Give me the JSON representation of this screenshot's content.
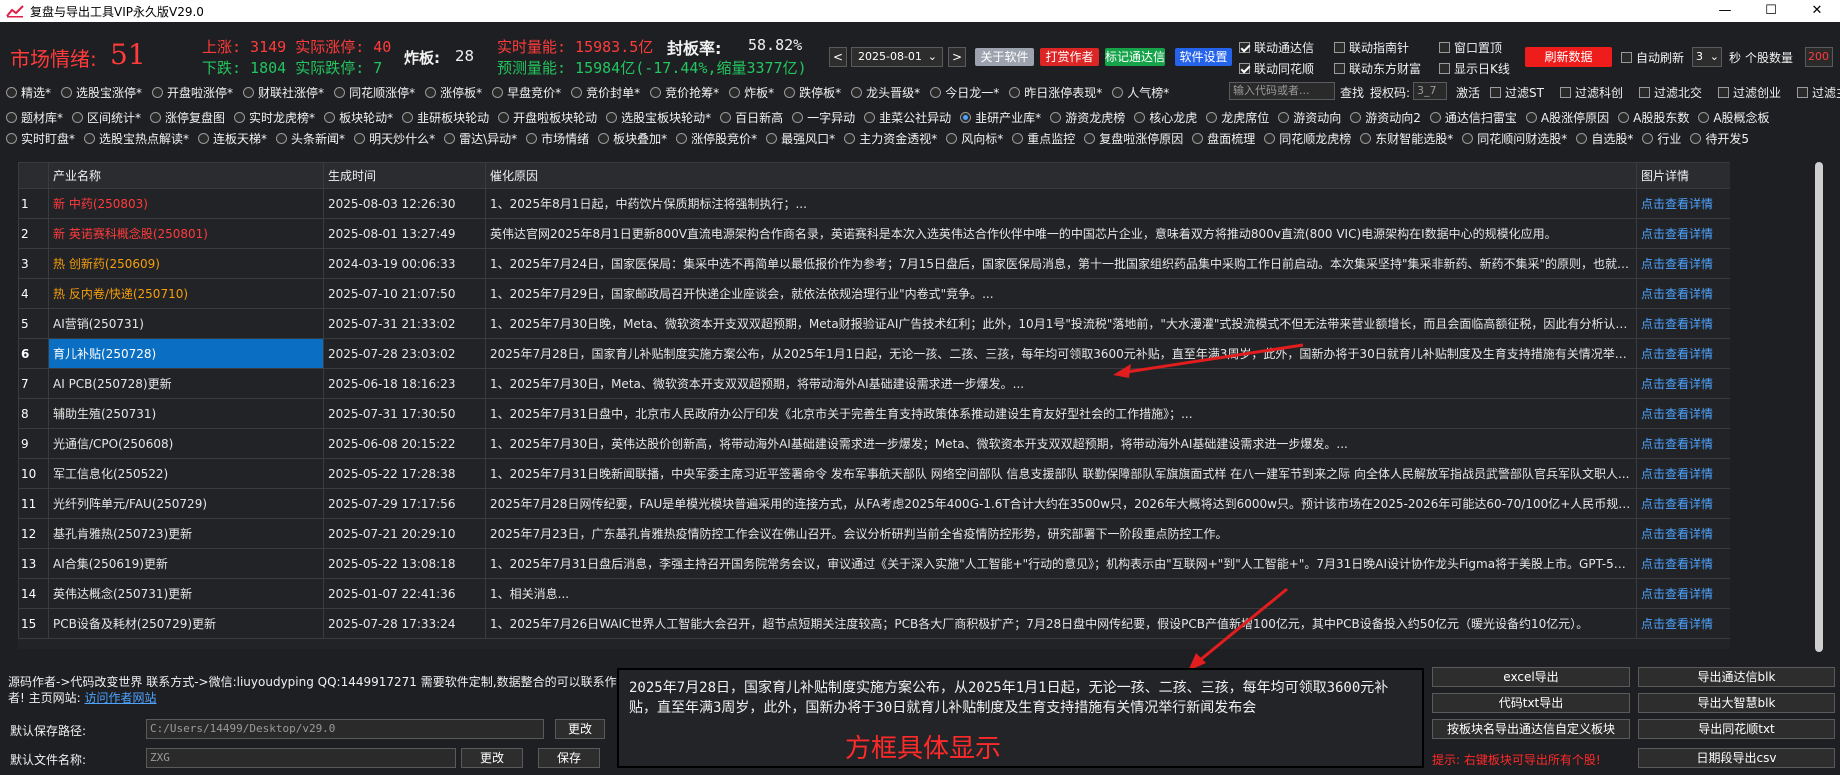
{
  "window": {
    "title": "复盘与导出工具VIP永久版V29.0",
    "controls": [
      "—",
      "☐",
      "✕"
    ]
  },
  "header": {
    "market_sentiment_label": "市场情绪:",
    "market_sentiment_value": "51",
    "up_text": "上涨: 3149  实际涨停: 40",
    "down_text": "下跌: 1804  实际跌停: 7",
    "zhaban_label": "炸板:",
    "zhaban_value": "28",
    "volume_realtime": "实时量能: 15983.5亿",
    "seal_rate_label": "封板率:",
    "seal_rate_value": "58.82%",
    "volume_forecast": "预测量能: 15984亿(-17.44%,缩量3377亿)",
    "date_value": "2025-08-01",
    "buttons": {
      "about": "关于软件",
      "tip": "打赏作者",
      "mark": "标记通达信",
      "settings": "软件设置",
      "refresh": "刷新数据"
    },
    "checks": {
      "link_tdx": "联动通达信",
      "link_zhinan": "联动指南针",
      "window_top": "窗口置顶",
      "link_ths": "联动同花顺",
      "link_dfcf": "联动东方财富",
      "show_kline": "显示日K线",
      "auto_refresh": "自动刷新"
    },
    "interval_value": "3",
    "interval_unit": "秒",
    "count_label": "个股数量",
    "count_value": "200"
  },
  "filters": {
    "row1": [
      "精选*",
      "选股宝涨停*",
      "开盘啦涨停*",
      "财联社涨停*",
      "同花顺涨停*",
      "涨停板*",
      "早盘竞价*",
      "竞价封单*",
      "竞价抢筹*",
      "炸板*",
      "跌停板*",
      "龙头晋级*",
      "今日龙一*",
      "昨日涨停表现*",
      "人气榜*"
    ],
    "search_placeholder": "输入代码或者...",
    "search_button": "查找",
    "auth_label": "授权码:",
    "auth_value": "3_7",
    "activate_label": "激活",
    "row1_right": [
      "过滤ST",
      "过滤科创",
      "过滤北交",
      "过滤创业",
      "过滤主板"
    ],
    "row2": [
      "题材库*",
      "区间统计*",
      "涨停复盘图",
      "实时龙虎榜*",
      "板块轮动*",
      "韭研板块轮动",
      "开盘啦板块轮动",
      "选股宝板块轮动*",
      "百日新高",
      "一字异动",
      "韭菜公社异动",
      "韭研产业库*",
      "游资龙虎榜",
      "核心龙虎",
      "龙虎席位",
      "游资动向",
      "游资动向2",
      "通达信扫雷宝",
      "A股涨停原因",
      "A股股东数",
      "A股概念板"
    ],
    "row3": [
      "实时盯盘*",
      "选股宝热点解读*",
      "连板天梯*",
      "头条新闻*",
      "明天炒什么*",
      "雷达\\异动*",
      "市场情绪",
      "板块叠加*",
      "涨停股竞价*",
      "最强风口*",
      "主力资金透视*",
      "风向标*",
      "重点监控",
      "复盘啦涨停原因",
      "盘面梳理",
      "同花顺龙虎榜",
      "东财智能选股*",
      "同花顺问财选股*",
      "自选股*",
      "行业",
      "待开发5"
    ]
  },
  "table": {
    "columns": [
      "",
      "产业名称",
      "生成时间",
      "催化原因",
      "图片详情"
    ],
    "rows": [
      {
        "idx": "1",
        "name": "新 中药(250803)",
        "time": "2025-08-03 12:26:30",
        "reason": "1、2025年8月1日起，中药饮片保质期标注将强制执行；...",
        "link": "点击查看详情",
        "color": "red"
      },
      {
        "idx": "2",
        "name": "新 英诺赛科概念股(250801)",
        "time": "2025-08-01 13:27:49",
        "reason": "英伟达官网2025年8月1日更新800V直流电源架构合作商名录，英诺赛科是本次入选英伟达合作伙伴中唯一的中国芯片企业，意味着双方将推动800v直流(800 VIC)电源架构在I数据中心的规模化应用。",
        "link": "点击查看详情",
        "color": "red"
      },
      {
        "idx": "3",
        "name": "热 创新药(250609)",
        "time": "2024-03-19 00:06:33",
        "reason": "1、2025年7月24日，国家医保局：集采中选不再简单以最低报价作为参考；7月15日盘后，国家医保局消息，第十一批国家组织药品集中采购工作日前启动。本次集采坚持\"集采非新药、新药不集采\"的原则，也就是...",
        "link": "点击查看详情",
        "color": "orange"
      },
      {
        "idx": "4",
        "name": "热 反内卷/快递(250710)",
        "time": "2025-07-10 21:07:50",
        "reason": "1、2025年7月29日，国家邮政局召开快递企业座谈会，就依法依规治理行业\"内卷式\"竞争。...",
        "link": "点击查看详情",
        "color": "orange"
      },
      {
        "idx": "5",
        "name": "AI营销(250731)",
        "time": "2025-07-31 21:33:02",
        "reason": "1、2025年7月30日晚，Meta、微软资本开支双双超预期，Meta财报验证AI广告技术红利；此外，10月1号\"投流税\"落地前，\"大水漫灌\"式投流模式不但无法带来营业额增长，而且会面临高额征税，因此有分析认为...",
        "link": "点击查看详情",
        "color": ""
      },
      {
        "idx": "6",
        "name": "育儿补贴(250728)",
        "time": "2025-07-28 23:03:02",
        "reason": "2025年7月28日，国家育儿补贴制度实施方案公布，从2025年1月1日起，无论一孩、二孩、三孩，每年均可领取3600元补贴，直至年满3周岁，此外，国新办将于30日就育儿补贴制度及生育支持措施有关情况举行...",
        "link": "点击查看详情",
        "color": "",
        "selected": true
      },
      {
        "idx": "7",
        "name": "AI PCB(250728)更新",
        "time": "2025-06-18 18:16:23",
        "reason": "1、2025年7月30日，Meta、微软资本开支双双超预期，将带动海外AI基础建设需求进一步爆发。...",
        "link": "点击查看详情",
        "color": ""
      },
      {
        "idx": "8",
        "name": "辅助生殖(250731)",
        "time": "2025-07-31 17:30:50",
        "reason": "1、2025年7月31日盘中，北京市人民政府办公厅印发《北京市关于完善生育支持政策体系推动建设生育友好型社会的工作措施》；...",
        "link": "点击查看详情",
        "color": ""
      },
      {
        "idx": "9",
        "name": "光通信/CPO(250608)",
        "time": "2025-06-08 20:15:22",
        "reason": "1、2025年7月30日，英伟达股价创新高，将带动海外AI基础建设需求进一步爆发；Meta、微软资本开支双双超预期，将带动海外AI基础建设需求进一步爆发。...",
        "link": "点击查看详情",
        "color": ""
      },
      {
        "idx": "10",
        "name": "军工信息化(250522)",
        "time": "2025-05-22 17:28:38",
        "reason": "1、2025年7月31日晚新闻联播，中央军委主席习近平签署命令 发布军事航天部队 网络空间部队 信息支援部队 联勤保障部队军旗旗面式样 在八一建军节到来之际 向全体人民解放军指战员武警部队官兵军队文职人...",
        "link": "点击查看详情",
        "color": ""
      },
      {
        "idx": "11",
        "name": "光纤列阵单元/FAU(250729)",
        "time": "2025-07-29 17:17:56",
        "reason": "2025年7月28日网传纪要，FAU是单模光模块普遍采用的连接方式，从FA考虑2025年400G-1.6T合计大约在3500w只，2026年大概将达到6000w只。预计该市场在2025-2026年可能达60-70/100亿+人民币规模，...",
        "link": "点击查看详情",
        "color": ""
      },
      {
        "idx": "12",
        "name": "基孔肯雅热(250723)更新",
        "time": "2025-07-21 20:29:10",
        "reason": "2025年7月23日，广东基孔肯雅热疫情防控工作会议在佛山召开。会议分析研判当前全省疫情防控形势，研究部署下一阶段重点防控工作。",
        "link": "点击查看详情",
        "color": ""
      },
      {
        "idx": "13",
        "name": "AI合集(250619)更新",
        "time": "2025-05-22 13:08:18",
        "reason": "1、2025年7月31日盘后消息，李强主持召开国务院常务会议，审议通过《关于深入实施\"人工智能+\"行动的意见》；机构表示由\"互联网+\"到\"人工智能+\"。7月31日晚AI设计协作龙头Figma将于美股上市。GPT-5有...",
        "link": "点击查看详情",
        "color": ""
      },
      {
        "idx": "14",
        "name": "英伟达概念(250731)更新",
        "time": "2025-01-07 22:41:36",
        "reason": "1、相关消息...",
        "link": "点击查看详情",
        "color": ""
      },
      {
        "idx": "15",
        "name": "PCB设备及耗材(250729)更新",
        "time": "2025-07-28 17:33:24",
        "reason": "1、2025年7月26日WAIC世界人工智能大会召开，超节点短期关注度较高；PCB各大厂商积极扩产；7月28日盘中网传纪要，假设PCB产值新增100亿元，其中PCB设备投入约50亿元（暖光设备约10亿元）。",
        "link": "点击查看详情",
        "color": ""
      }
    ]
  },
  "footer": {
    "author_line1": "源码作者->代码改变世界 联系方式->微信:liuyoudyping QQ:1449917271 需要软件定制,数据整合的可以联系作",
    "author_line2_prefix": "者! 主页网站:",
    "author_link": "访问作者网站",
    "save_path_label": "默认保存路径:",
    "save_path_value": "C:/Users/14499/Desktop/v29.0",
    "change_button": "更改",
    "file_name_label": "默认文件名称:",
    "file_name_value": "ZXG",
    "change_button2": "更改",
    "save_button": "保存",
    "detail_text": "2025年7月28日，国家育儿补贴制度实施方案公布，从2025年1月1日起，无论一孩、二孩、三孩，每年均可领取3600元补贴，直至年满3周岁，此外，国新办将于30日就育儿补贴制度及生育支持措施有关情况举行新闻发布会",
    "detail_caption": "方框具体显示",
    "export_buttons": [
      "excel导出",
      "导出通达信blk",
      "代码txt导出",
      "导出大智慧blk",
      "按板块名导出通达信自定义板块",
      "导出同花顺txt",
      "日期段导出csv"
    ],
    "hint": "提示: 右键板块可导出所有个股!"
  }
}
